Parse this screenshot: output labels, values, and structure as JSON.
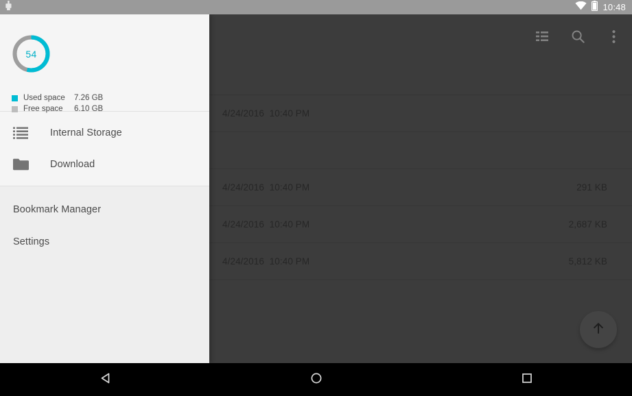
{
  "status_bar": {
    "notification_icon": "usb-connection-icon",
    "wifi_icon": "wifi-icon",
    "battery_icon": "battery-icon",
    "time": "10:48"
  },
  "app_bar": {
    "actions": [
      {
        "name": "view-list-icon",
        "label": "List view"
      },
      {
        "name": "search-icon",
        "label": "Search"
      },
      {
        "name": "overflow-menu-icon",
        "label": "More options"
      }
    ]
  },
  "file_list": {
    "rows": [
      {
        "name": "",
        "date": "",
        "size": "",
        "height": "spacer-top"
      },
      {
        "name": "",
        "date": "4/24/2016  10:40 PM",
        "size": ""
      },
      {
        "name": "",
        "date": "",
        "size": ""
      },
      {
        "name": "",
        "date": "4/24/2016  10:40 PM",
        "size": "291 KB"
      },
      {
        "name": "",
        "date": "4/24/2016  10:40 PM",
        "size": "2,687 KB"
      },
      {
        "name": "",
        "date": "4/24/2016  10:40 PM",
        "size": "5,812 KB"
      }
    ]
  },
  "fab": {
    "icon": "arrow-up-icon",
    "label": "Go up"
  },
  "drawer": {
    "storage": {
      "percent_label": "54",
      "percent_value": 54,
      "accent_color": "#00bcd4",
      "track_color": "#9e9e9e",
      "legend": [
        {
          "swatch": "used",
          "name": "Used space",
          "value": "7.26 GB"
        },
        {
          "swatch": "free",
          "name": "Free space",
          "value": "6.10 GB"
        }
      ]
    },
    "sections": [
      {
        "items": [
          {
            "icon": "storage-list-icon",
            "label": "Internal Storage"
          },
          {
            "icon": "folder-icon",
            "label": "Download"
          }
        ]
      },
      {
        "items": [
          {
            "icon": null,
            "label": "Bookmark Manager"
          },
          {
            "icon": null,
            "label": "Settings"
          }
        ]
      }
    ]
  },
  "nav_bar": {
    "buttons": [
      {
        "name": "back-button",
        "icon": "triangle-left-icon",
        "label": "Back"
      },
      {
        "name": "home-button",
        "icon": "circle-icon",
        "label": "Home"
      },
      {
        "name": "recents-button",
        "icon": "square-icon",
        "label": "Recent apps"
      }
    ]
  },
  "chart_data": {
    "type": "pie",
    "title": "Storage usage",
    "categories": [
      "Used space",
      "Free space"
    ],
    "values": [
      7.26,
      6.1
    ],
    "units": "GB",
    "percent_used": 54,
    "colors": [
      "#00bcd4",
      "#9e9e9e"
    ],
    "center_label": "54",
    "legend_position": "below",
    "donut": true
  }
}
